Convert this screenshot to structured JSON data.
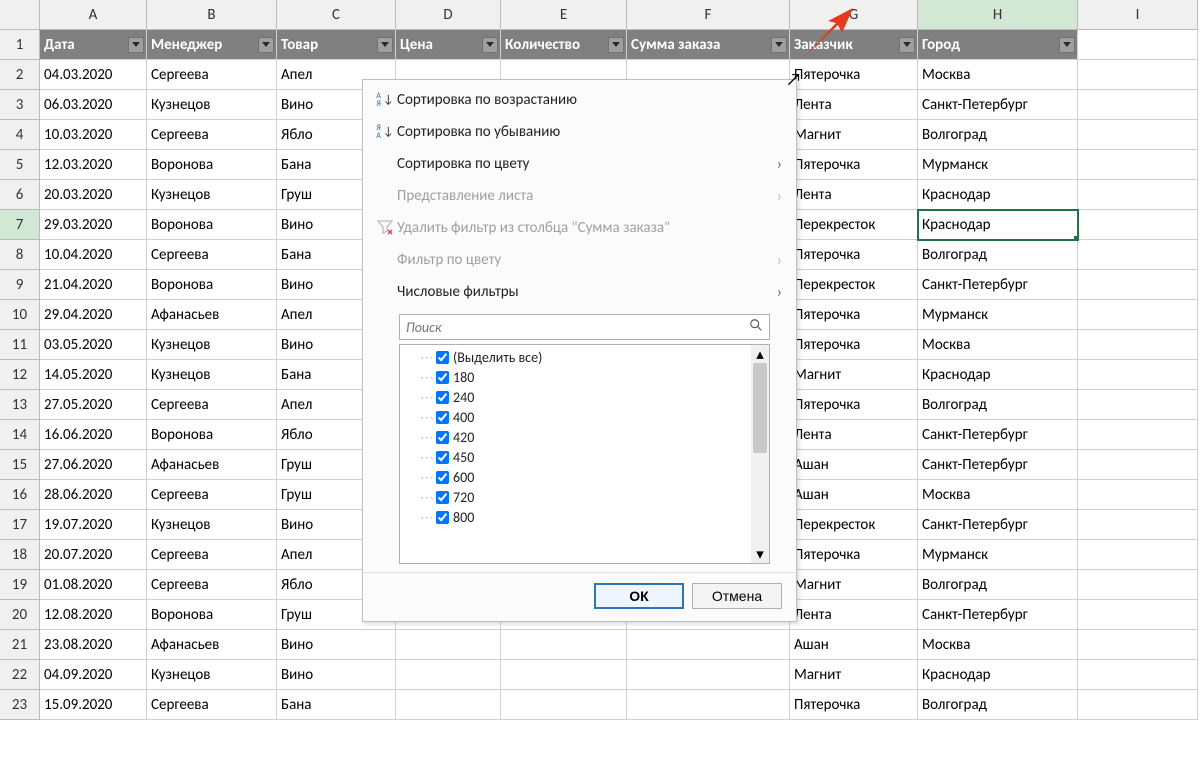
{
  "columns": [
    "A",
    "B",
    "C",
    "D",
    "E",
    "F",
    "G",
    "H",
    "I"
  ],
  "rows": [
    "1",
    "2",
    "3",
    "4",
    "5",
    "6",
    "7",
    "8",
    "9",
    "10",
    "11",
    "12",
    "13",
    "14",
    "15",
    "16",
    "17",
    "18",
    "19",
    "20",
    "21",
    "22",
    "23"
  ],
  "headers": [
    "Дата",
    "Менеджер",
    "Товар",
    "Цена",
    "Количество",
    "Сумма заказа",
    "Заказчик",
    "Город"
  ],
  "active_row_index": 6,
  "active_col_index": 7,
  "data": [
    [
      "04.03.2020",
      "Сергеева",
      "Апел",
      "",
      "",
      "",
      "Пятерочка",
      "Москва"
    ],
    [
      "06.03.2020",
      "Кузнецов",
      "Вино",
      "",
      "",
      "",
      "Лента",
      "Санкт-Петербург"
    ],
    [
      "10.03.2020",
      "Сергеева",
      "Ябло",
      "",
      "",
      "",
      "Магнит",
      "Волгоград"
    ],
    [
      "12.03.2020",
      "Воронова",
      "Бана",
      "",
      "",
      "",
      "Пятерочка",
      "Мурманск"
    ],
    [
      "20.03.2020",
      "Кузнецов",
      "Груш",
      "",
      "",
      "",
      "Лента",
      "Краснодар"
    ],
    [
      "29.03.2020",
      "Воронова",
      "Вино",
      "",
      "",
      "",
      "Перекресток",
      "Краснодар"
    ],
    [
      "10.04.2020",
      "Сергеева",
      "Бана",
      "",
      "",
      "",
      "Пятерочка",
      "Волгоград"
    ],
    [
      "21.04.2020",
      "Воронова",
      "Вино",
      "",
      "",
      "",
      "Перекресток",
      "Санкт-Петербург"
    ],
    [
      "29.04.2020",
      "Афанасьев",
      "Апел",
      "",
      "",
      "",
      "Пятерочка",
      "Мурманск"
    ],
    [
      "03.05.2020",
      "Кузнецов",
      "Вино",
      "",
      "",
      "",
      "Пятерочка",
      "Москва"
    ],
    [
      "14.05.2020",
      "Кузнецов",
      "Бана",
      "",
      "",
      "",
      "Магнит",
      "Краснодар"
    ],
    [
      "27.05.2020",
      "Сергеева",
      "Апел",
      "",
      "",
      "",
      "Пятерочка",
      "Волгоград"
    ],
    [
      "16.06.2020",
      "Воронова",
      "Ябло",
      "",
      "",
      "",
      "Лента",
      "Санкт-Петербург"
    ],
    [
      "27.06.2020",
      "Афанасьев",
      "Груш",
      "",
      "",
      "",
      "Ашан",
      "Санкт-Петербург"
    ],
    [
      "28.06.2020",
      "Сергеева",
      "Груш",
      "",
      "",
      "",
      "Ашан",
      "Москва"
    ],
    [
      "19.07.2020",
      "Кузнецов",
      "Вино",
      "",
      "",
      "",
      "Перекресток",
      "Санкт-Петербург"
    ],
    [
      "20.07.2020",
      "Сергеева",
      "Апел",
      "",
      "",
      "",
      "Пятерочка",
      "Мурманск"
    ],
    [
      "01.08.2020",
      "Сергеева",
      "Ябло",
      "",
      "",
      "",
      "Магнит",
      "Волгоград"
    ],
    [
      "12.08.2020",
      "Воронова",
      "Груш",
      "",
      "",
      "",
      "Лента",
      "Санкт-Петербург"
    ],
    [
      "23.08.2020",
      "Афанасьев",
      "Вино",
      "",
      "",
      "",
      "Ашан",
      "Москва"
    ],
    [
      "04.09.2020",
      "Кузнецов",
      "Вино",
      "",
      "",
      "",
      "Магнит",
      "Краснодар"
    ],
    [
      "15.09.2020",
      "Сергеева",
      "Бана",
      "",
      "",
      "",
      "Пятерочка",
      "Волгоград"
    ]
  ],
  "filter_menu": {
    "sort_asc": "Сортировка по возрастанию",
    "sort_desc": "Сортировка по убыванию",
    "sort_color": "Сортировка по цвету",
    "sheet_view": "Представление листа",
    "clear_filter": "Удалить фильтр из столбца \"Сумма заказа\"",
    "filter_color": "Фильтр по цвету",
    "number_filters": "Числовые фильтры",
    "search_placeholder": "Поиск",
    "select_all": "(Выделить все)",
    "values": [
      "180",
      "240",
      "400",
      "420",
      "450",
      "600",
      "720",
      "800"
    ],
    "ok": "ОК",
    "cancel": "Отмена"
  }
}
